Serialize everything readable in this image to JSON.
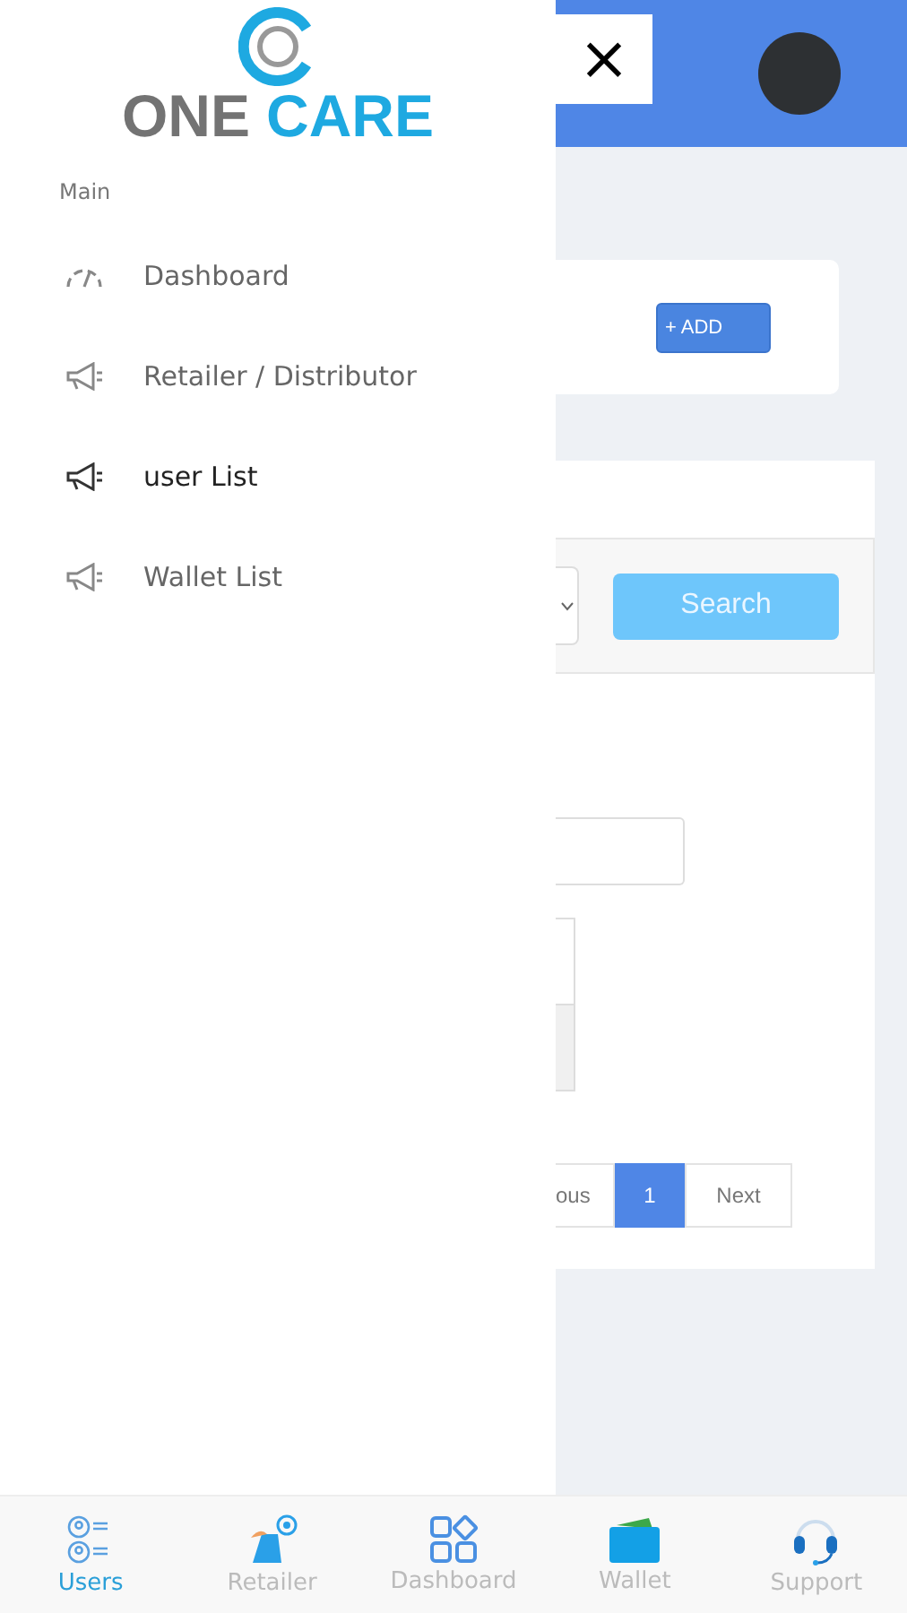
{
  "logo": {
    "word_1": "ONE",
    "word_2": "CARE"
  },
  "sidebar": {
    "section": "Main",
    "items": [
      {
        "label": "Dashboard",
        "kind": "gauge",
        "selected": false
      },
      {
        "label": "Retailer / Distributor",
        "kind": "megaphone",
        "selected": false
      },
      {
        "label": "user List",
        "kind": "megaphone",
        "selected": true
      },
      {
        "label": "Wallet List",
        "kind": "megaphone",
        "selected": false
      }
    ]
  },
  "header": {
    "close": "×"
  },
  "add_button": "+ ADD",
  "search_button": "Search",
  "pagination": [
    {
      "label": "ous",
      "selected": false
    },
    {
      "label": "1",
      "selected": true
    },
    {
      "label": "Next",
      "selected": false
    }
  ],
  "bottom_nav": [
    {
      "label": "Users",
      "kind": "users",
      "selected": true
    },
    {
      "label": "Retailer",
      "kind": "retailer",
      "selected": false
    },
    {
      "label": "Dashboard",
      "kind": "grid",
      "selected": false
    },
    {
      "label": "Wallet",
      "kind": "wallet",
      "selected": false
    },
    {
      "label": "Support",
      "kind": "headset",
      "selected": false
    }
  ]
}
